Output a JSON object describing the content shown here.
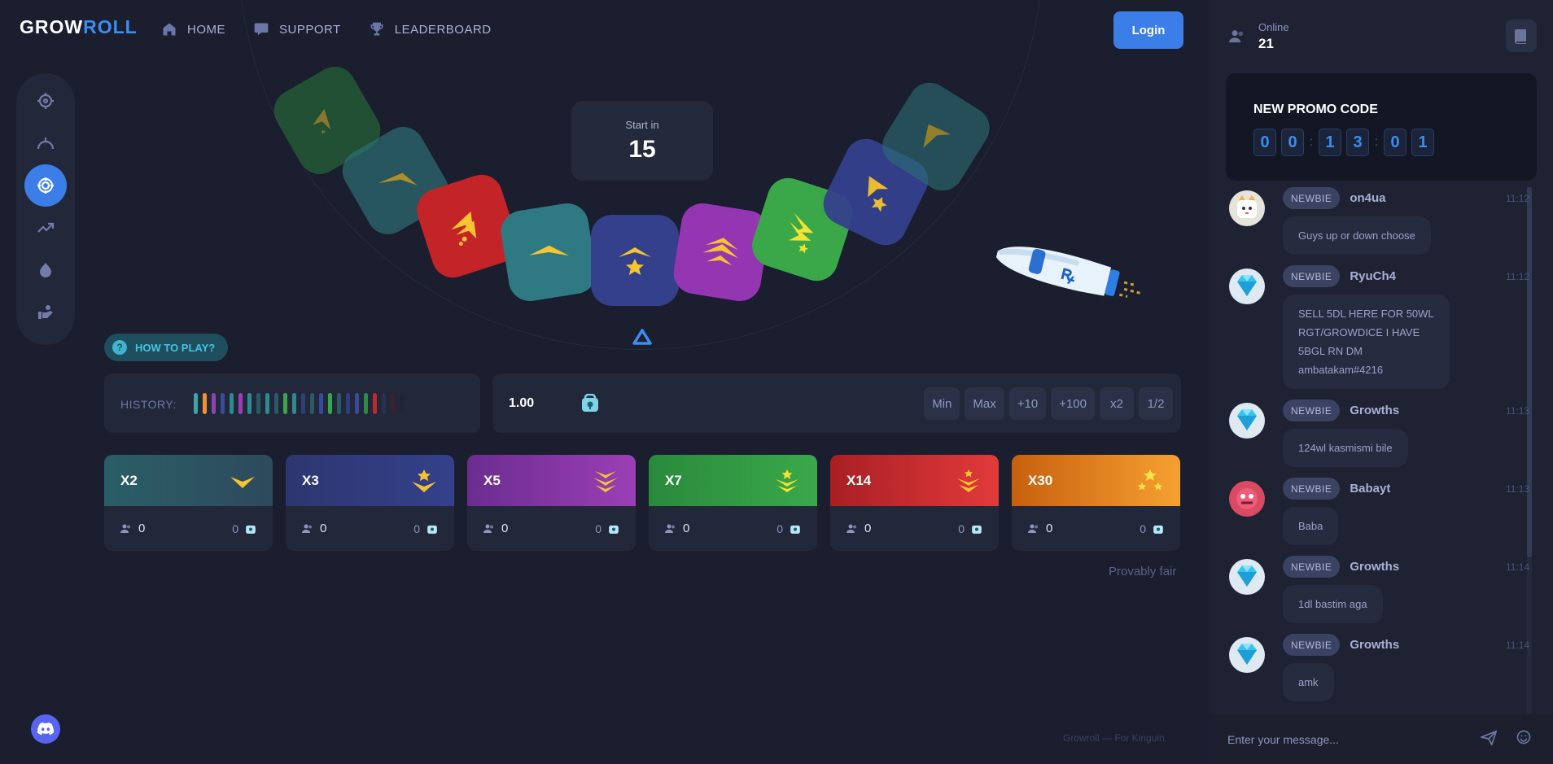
{
  "brand": {
    "prefix": "GROW",
    "suffix": "ROLL"
  },
  "nav": [
    {
      "label": "HOME",
      "icon": "home-icon"
    },
    {
      "label": "SUPPORT",
      "icon": "chat-bubble-icon"
    },
    {
      "label": "LEADERBOARD",
      "icon": "trophy-icon"
    }
  ],
  "header": {
    "login_label": "Login"
  },
  "sidebar": [
    {
      "icon": "crosshair-icon",
      "active": false
    },
    {
      "icon": "crash-icon",
      "active": false
    },
    {
      "icon": "roulette-icon",
      "active": true
    },
    {
      "icon": "trend-up-icon",
      "active": false
    },
    {
      "icon": "bomb-icon",
      "active": false
    },
    {
      "icon": "affiliate-icon",
      "active": false
    }
  ],
  "game": {
    "start_label": "Start in",
    "countdown": "15",
    "how_to_play": "HOW TO PLAY?",
    "history_label": "HISTORY:",
    "history_colors": [
      "#3fa4a6",
      "#f0932b",
      "#8e44ad",
      "#3a4a9a",
      "#2f8a8e",
      "#9b3fb5",
      "#2f8a8e",
      "#2a5a64",
      "#2f8a8e",
      "#2a5a64",
      "#3aa84a",
      "#2f8a8e",
      "#2f3f7a",
      "#2a5a64",
      "#3a4a9a",
      "#33a84a",
      "#2a5a64",
      "#2f3f7a",
      "#3a4a9a",
      "#2f8a43",
      "#c0282e",
      "#2a3050",
      "#3a2030",
      "#1f2436"
    ],
    "bet_value": "1.00",
    "bet_buttons": [
      "Min",
      "Max",
      "+10",
      "+100",
      "x2",
      "1/2"
    ],
    "provably_fair": "Provably fair",
    "footer_note": "Growroll — For Kinguin."
  },
  "multipliers": [
    {
      "label": "X2",
      "users": "0",
      "amount": "0",
      "color_a": "#2a5a64",
      "color_b": "#2e4e60",
      "icon": "chevron-icon"
    },
    {
      "label": "X3",
      "users": "0",
      "amount": "0",
      "color_a": "#2e3a72",
      "color_b": "#34428a",
      "icon": "chevron-star-icon"
    },
    {
      "label": "X5",
      "users": "0",
      "amount": "0",
      "color_a": "#6a2d8f",
      "color_b": "#9b3fb5",
      "icon": "triple-chevron-icon"
    },
    {
      "label": "X7",
      "users": "0",
      "amount": "0",
      "color_a": "#2a8a3c",
      "color_b": "#3aa84a",
      "icon": "chevron-stars-icon"
    },
    {
      "label": "X14",
      "users": "0",
      "amount": "0",
      "color_a": "#a81f24",
      "color_b": "#e23a3a",
      "icon": "chevron-three-stars-icon"
    },
    {
      "label": "X30",
      "users": "0",
      "amount": "0",
      "color_a": "#d46a12",
      "color_b": "#f5a030",
      "icon": "star-cluster-icon"
    }
  ],
  "panel": {
    "online_label": "Online",
    "online_count": "21",
    "promo_title": "NEW PROMO CODE",
    "promo_digits": [
      "0",
      "0",
      "1",
      "3",
      "0",
      "1"
    ],
    "chat_placeholder": "Enter your message..."
  },
  "chat": [
    {
      "badge": "NEWBIE",
      "user": "on4ua",
      "time": "11:12",
      "lines": [
        "Guys up or down choose"
      ],
      "avatar": "cat-avatar"
    },
    {
      "badge": "NEWBIE",
      "user": "RyuCh4",
      "time": "11:12",
      "lines": [
        "SELL 5DL HERE FOR 50WL",
        "RGT/GROWDICE I HAVE",
        "5BGL RN DM",
        "ambatakam#4216"
      ],
      "avatar": "diamond-avatar"
    },
    {
      "badge": "NEWBIE",
      "user": "Growths",
      "time": "11:13",
      "lines": [
        "124wl kasmismi bile"
      ],
      "avatar": "diamond-avatar"
    },
    {
      "badge": "NEWBIE",
      "user": "Babayt",
      "time": "11:13",
      "lines": [
        "Baba"
      ],
      "avatar": "monster-avatar"
    },
    {
      "badge": "NEWBIE",
      "user": "Growths",
      "time": "11:14",
      "lines": [
        "1dl bastim aga"
      ],
      "avatar": "diamond-avatar"
    },
    {
      "badge": "NEWBIE",
      "user": "Growths",
      "time": "11:14",
      "lines": [
        "amk"
      ],
      "avatar": "diamond-avatar"
    }
  ]
}
